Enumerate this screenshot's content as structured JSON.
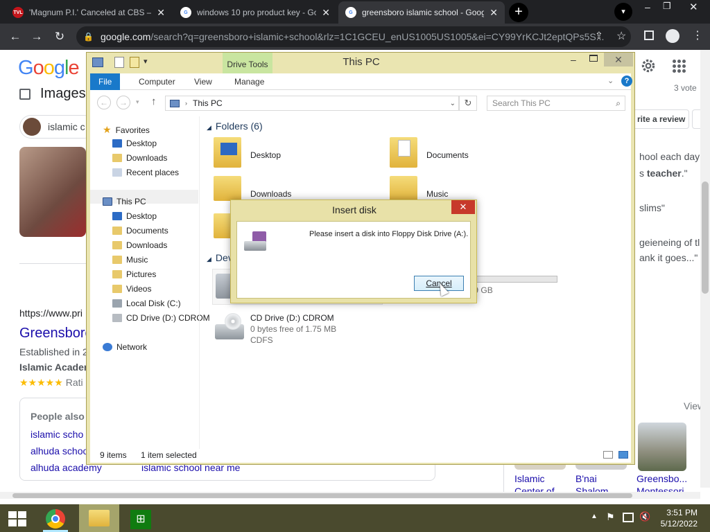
{
  "browser": {
    "tabs": [
      {
        "title": "'Magnum P.I.' Canceled at CBS –",
        "favicon": "tvline-icon",
        "active": false
      },
      {
        "title": "windows 10 pro product key - Go",
        "favicon": "google-icon",
        "active": false
      },
      {
        "title": "greensboro islamic school - Goog",
        "favicon": "google-icon",
        "active": true
      }
    ],
    "url_host": "google.com",
    "url_rest": "/search?q=greensboro+islamic+school&rlz=1C1GCEU_enUS1005US1005&ei=CY99YrKCJt2eptQPs5S..."
  },
  "google": {
    "logo": "Google",
    "images_label": "Images",
    "chip_text": "islamic c",
    "votes": "3 vote",
    "review_btn": "rite a review",
    "snippet1": "hool each day",
    "snippet2_pre": "s ",
    "snippet2_bold": "teacher",
    "snippet2_post": ".\"",
    "snippet3": "slims\"",
    "snippet4": "geieneing of tl",
    "snippet5": "ank it goes...\"",
    "result_url": "https://www.pri",
    "result_title": "Greensboro",
    "established": "Established in 2",
    "academy": "Islamic Acaden",
    "stars": "★★★★★",
    "rating": "Rati",
    "people_also": "People also",
    "related": [
      "islamic scho",
      "alhuda schoo",
      "alhuda academy"
    ],
    "related_right": "islamic school near me",
    "view_all": "View",
    "places": [
      {
        "name": "Islamic",
        "sub": "Center of"
      },
      {
        "name": "B'nai",
        "sub": "Shalom"
      },
      {
        "name": "Greensbo...",
        "sub": "Montessori"
      }
    ]
  },
  "explorer": {
    "title": "This PC",
    "drive_tools": "Drive Tools",
    "ribbon_tabs": [
      "File",
      "Computer",
      "View",
      "Manage"
    ],
    "address": "This PC",
    "search_placeholder": "Search This PC",
    "folders_header": "Folders (6)",
    "devices_header": "Dev",
    "nav_favorites": "Favorites",
    "nav_fav_items": [
      "Desktop",
      "Downloads",
      "Recent places"
    ],
    "nav_thispc": "This PC",
    "nav_pc_items": [
      "Desktop",
      "Documents",
      "Downloads",
      "Music",
      "Pictures",
      "Videos",
      "Local Disk (C:)",
      "CD Drive (D:) CDROM"
    ],
    "nav_network": "Network",
    "folders": [
      "Desktop",
      "Documents",
      "Downloads",
      "Music"
    ],
    "cd_name": "CD Drive (D:) CDROM",
    "cd_free": "0 bytes free of 1.75 MB",
    "cd_fs": "CDFS",
    "disk_free_tail": "159 GB",
    "status_items": "9 items",
    "status_selected": "1 item selected"
  },
  "dialog": {
    "title": "Insert disk",
    "message": "Please insert a disk into Floppy Disk Drive (A:).",
    "cancel": "Cancel"
  },
  "taskbar": {
    "time": "3:51 PM",
    "date": "5/12/2022"
  }
}
